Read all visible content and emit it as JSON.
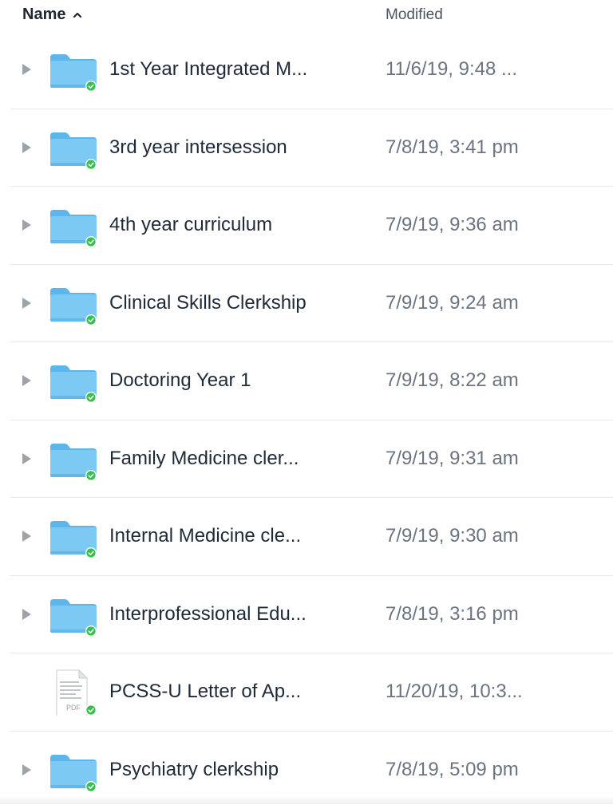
{
  "header": {
    "name_label": "Name",
    "modified_label": "Modified",
    "sort_icon": "chevron-up-icon"
  },
  "colors": {
    "folder": "#6ec1f1",
    "folder_dark": "#4fa9e0",
    "sync_badge": "#35c14b",
    "separator": "#e6e8eb"
  },
  "files": [
    {
      "name": "1st Year Integrated M...",
      "modified": "11/6/19, 9:48 ...",
      "type": "folder"
    },
    {
      "name": "3rd year intersession",
      "modified": "7/8/19, 3:41 pm",
      "type": "folder"
    },
    {
      "name": "4th year curriculum",
      "modified": "7/9/19, 9:36 am",
      "type": "folder"
    },
    {
      "name": "Clinical Skills Clerkship",
      "modified": "7/9/19, 9:24 am",
      "type": "folder"
    },
    {
      "name": "Doctoring Year 1",
      "modified": "7/9/19, 8:22 am",
      "type": "folder"
    },
    {
      "name": "Family Medicine cler...",
      "modified": "7/9/19, 9:31 am",
      "type": "folder"
    },
    {
      "name": "Internal Medicine cle...",
      "modified": "7/9/19, 9:30 am",
      "type": "folder"
    },
    {
      "name": "Interprofessional Edu...",
      "modified": "7/8/19, 3:16 pm",
      "type": "folder"
    },
    {
      "name": "PCSS-U Letter of Ap...",
      "modified": "11/20/19, 10:3...",
      "type": "pdf",
      "icon_label": "PDF"
    },
    {
      "name": "Psychiatry clerkship",
      "modified": "7/8/19, 5:09 pm",
      "type": "folder"
    }
  ]
}
